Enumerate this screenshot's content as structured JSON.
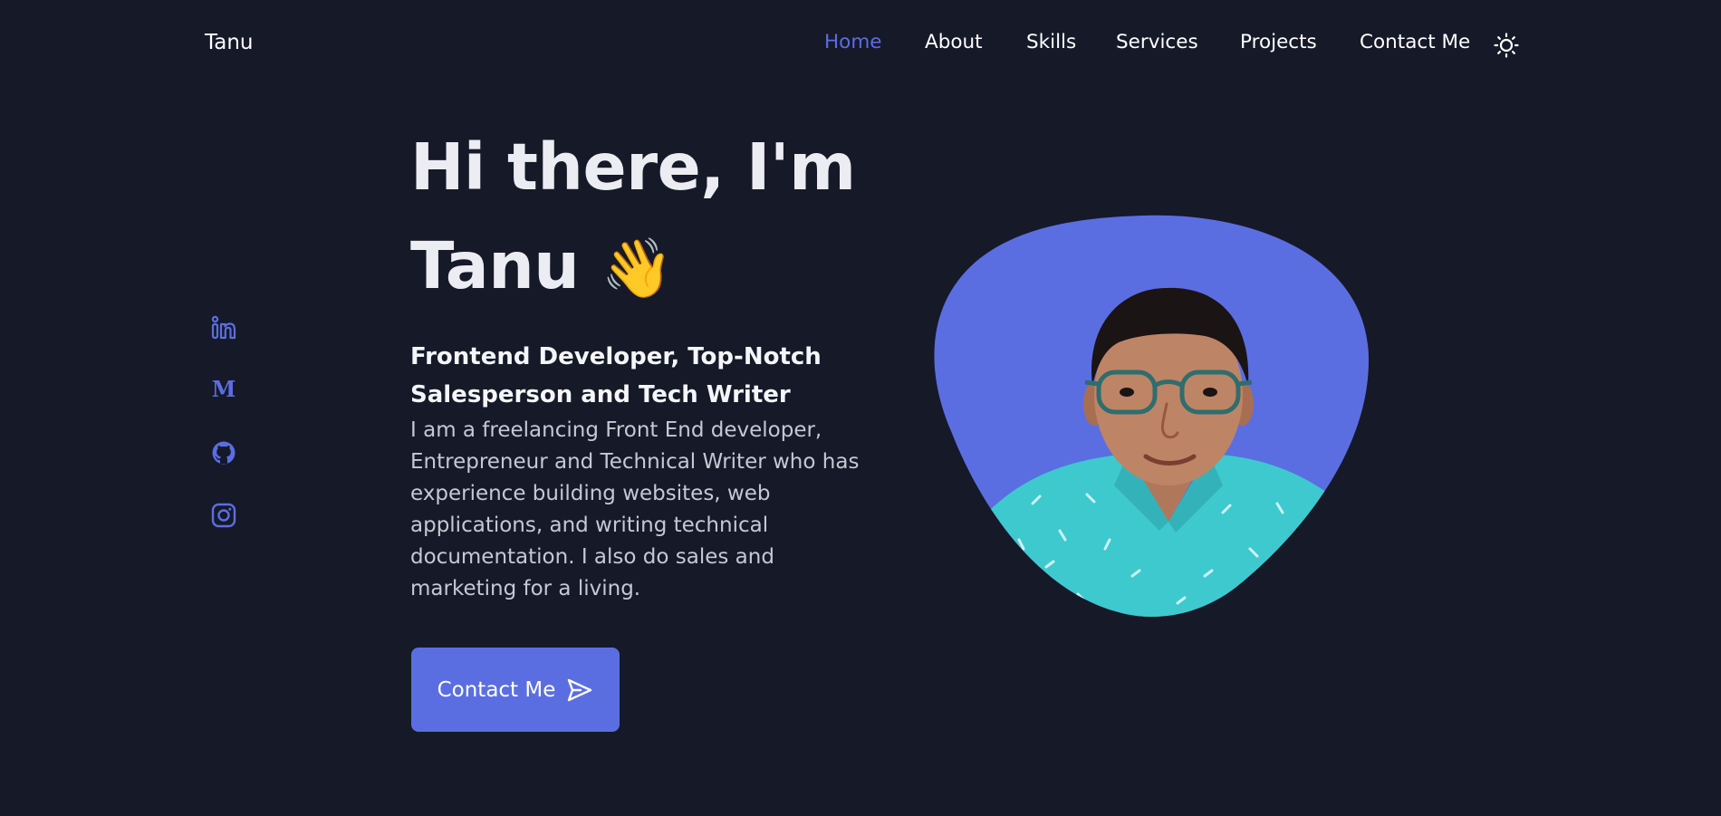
{
  "header": {
    "brand": "Tanu",
    "nav": [
      {
        "label": "Home",
        "active": true
      },
      {
        "label": "About",
        "active": false
      },
      {
        "label": "Skills",
        "active": false
      },
      {
        "label": "Services",
        "active": false
      },
      {
        "label": "Projects",
        "active": false
      },
      {
        "label": "Contact Me",
        "active": false
      }
    ],
    "theme_toggle_icon": "sun-icon"
  },
  "social": {
    "icons": [
      "linkedin-icon",
      "medium-icon",
      "github-icon",
      "instagram-icon"
    ]
  },
  "hero": {
    "title_line1": "Hi there, I'm",
    "title_line2": "Tanu",
    "wave_emoji": "👋",
    "subtitle": "Frontend Developer, Top-Notch Salesperson and Tech Writer",
    "description": "I am a freelancing Front End developer, Entrepreneur and Technical Writer who has experience building websites, web applications, and writing technical documentation. I also do sales and marketing for a living.",
    "cta_label": "Contact Me",
    "cta_icon": "send-icon"
  },
  "colors": {
    "background": "#161928",
    "accent": "#5b6ee1",
    "text": "#ffffff",
    "muted_text": "#c6c8d2",
    "shirt": "#3ec9cf"
  }
}
